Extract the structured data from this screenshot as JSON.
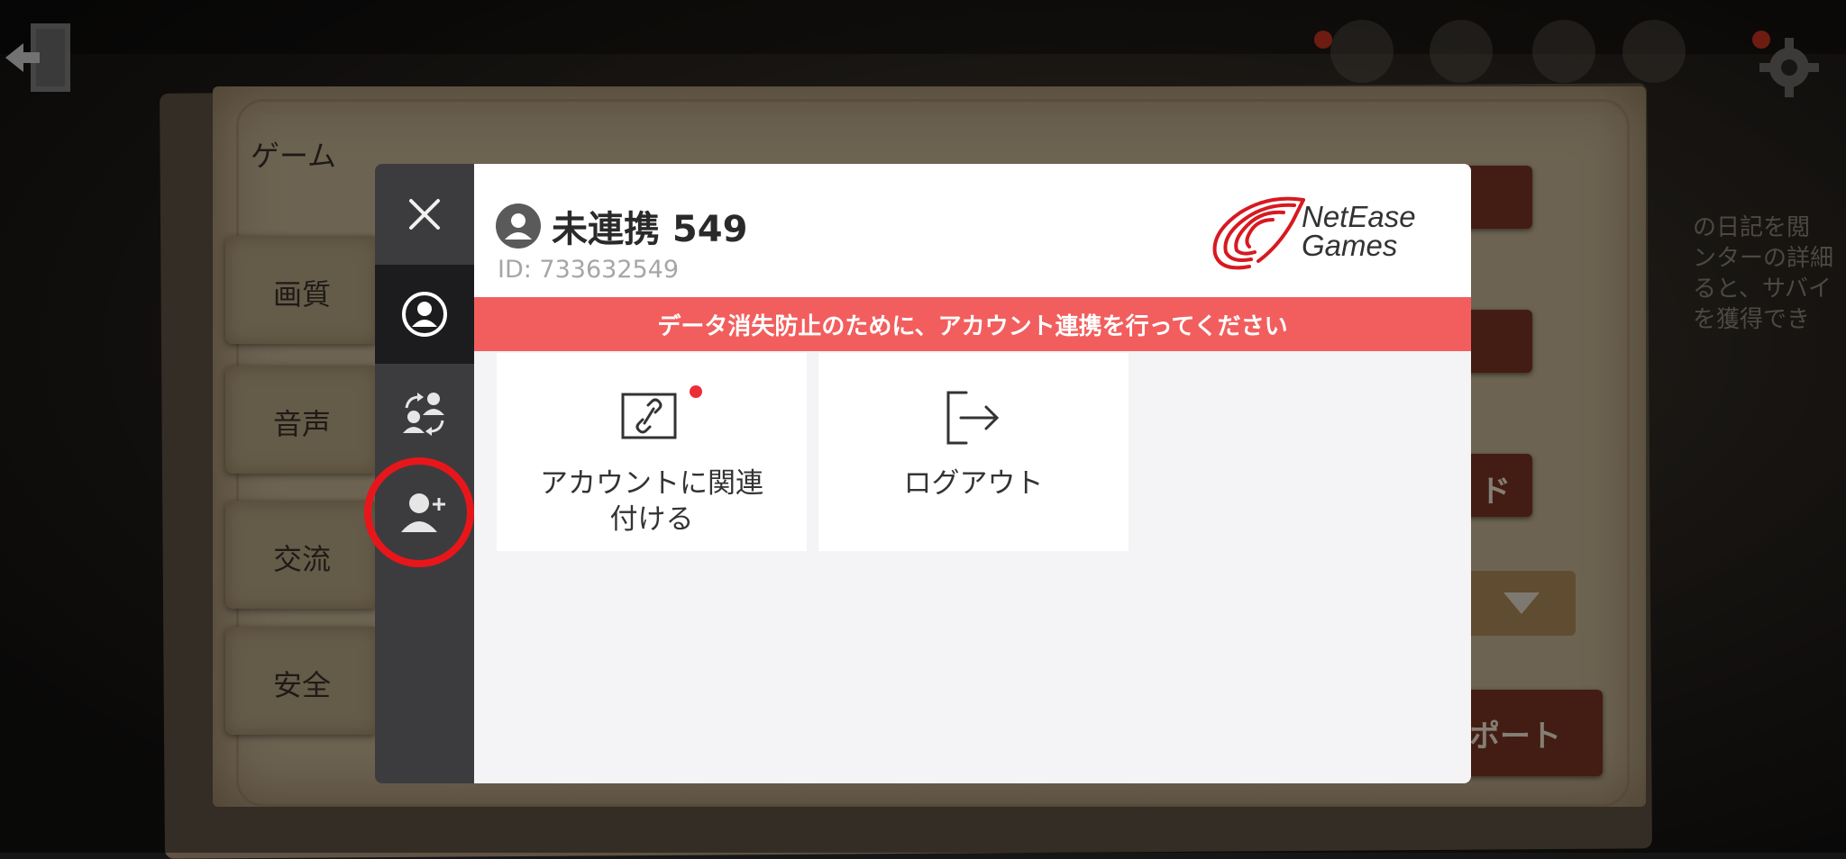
{
  "settings_menu": {
    "title": "ゲーム",
    "tabs": [
      "画質",
      "音声",
      "交流",
      "安全"
    ]
  },
  "right_panel": {
    "partial_button_1": "ド",
    "partial_button_2": "ポート",
    "side_text_lines": [
      "の日記を閲",
      "ンターの詳細",
      "ると、サバイ",
      "を獲得でき"
    ]
  },
  "dialog": {
    "close_icon": "close-icon",
    "nav": [
      {
        "icon": "account-icon",
        "active": true
      },
      {
        "icon": "switch-account-icon",
        "active": false
      },
      {
        "icon": "add-user-icon",
        "active": false
      }
    ],
    "user": {
      "name": "未連携 549",
      "id": "ID: 733632549"
    },
    "logo_text": [
      "NetEase",
      "Games"
    ],
    "banner": "データ消失防止のために、アカウント連携を行ってください",
    "cards": [
      {
        "label_line1": "アカウントに関連",
        "label_line2": "付ける",
        "icon": "link-icon",
        "has_badge": true
      },
      {
        "label_line1": "ログアウト",
        "label_line2": "",
        "icon": "logout-icon",
        "has_badge": false
      }
    ]
  },
  "colors": {
    "banner": "#f25e5e",
    "sidebar": "#3c3c3e",
    "sidebar_active": "#1c1c1e",
    "highlight_ring": "#e8161b",
    "logo_red": "#d71920"
  }
}
